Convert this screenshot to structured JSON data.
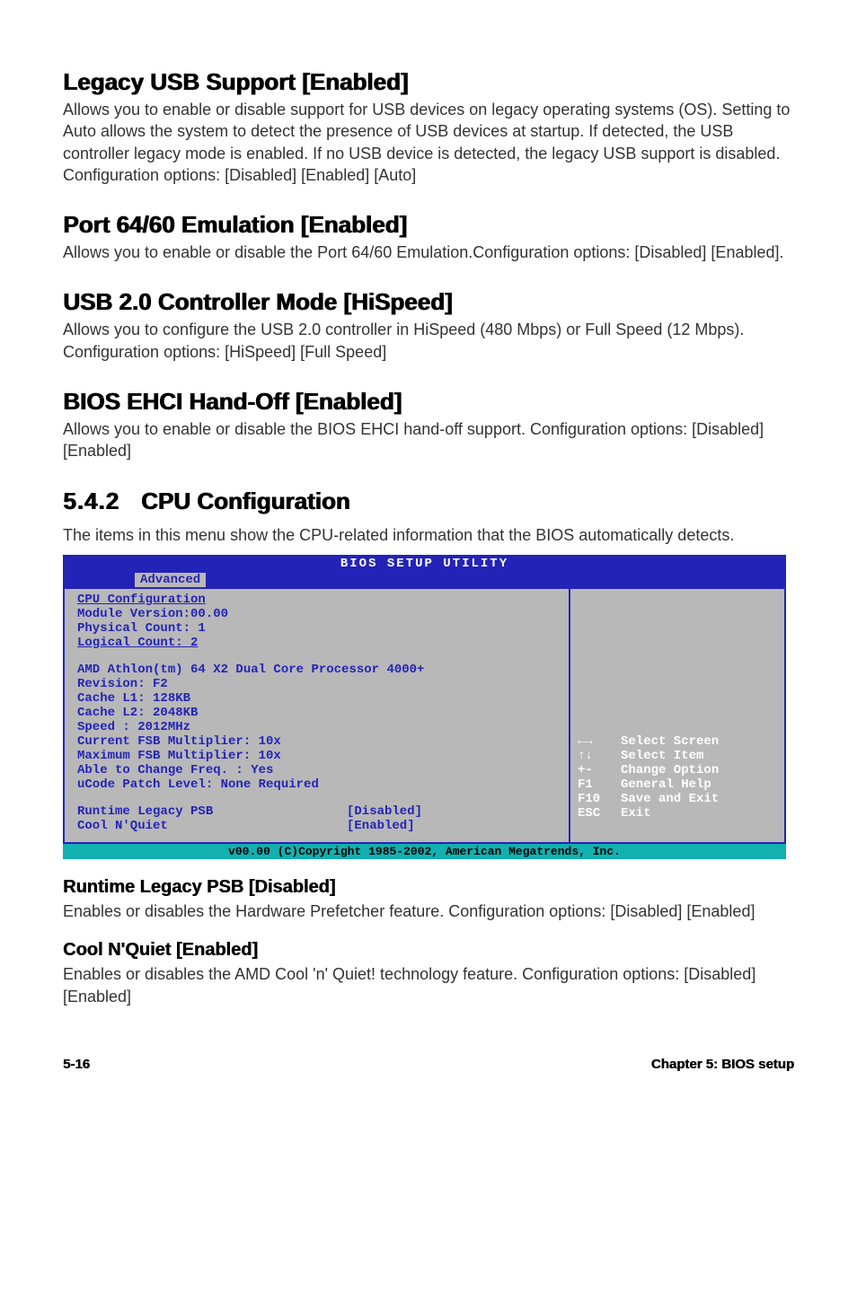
{
  "sections": {
    "legacy_usb": {
      "heading": "Legacy USB Support [Enabled]",
      "body": "Allows you to enable or disable support for USB devices on legacy operating systems (OS). Setting to Auto allows the system to detect the presence of USB devices at startup. If detected, the USB controller legacy mode is enabled. If no USB device is detected, the legacy USB support is disabled. Configuration options: [Disabled] [Enabled] [Auto]"
    },
    "port_6460": {
      "heading": "Port 64/60 Emulation [Enabled]",
      "body": "Allows you to enable or disable the Port 64/60 Emulation.Configuration options: [Disabled] [Enabled]."
    },
    "usb20_mode": {
      "heading": "USB 2.0 Controller Mode [HiSpeed]",
      "body": "Allows you to configure the USB 2.0 controller in HiSpeed (480 Mbps) or Full Speed (12 Mbps). Configuration options: [HiSpeed] [Full Speed]"
    },
    "bios_ehci": {
      "heading": "BIOS EHCI Hand-Off [Enabled]",
      "body": "Allows you to enable or disable the BIOS EHCI hand-off support. Configuration options: [Disabled] [Enabled]"
    },
    "cpu_config": {
      "heading_num": "5.4.2",
      "heading_title": "CPU Configuration",
      "body": "The items in this menu show the CPU-related information that the BIOS automatically detects."
    },
    "runtime_psb": {
      "heading": "Runtime Legacy PSB [Disabled]",
      "body": "Enables or disables the Hardware Prefetcher feature. Configuration options: [Disabled] [Enabled]"
    },
    "cool_n_quiet": {
      "heading": "Cool N'Quiet [Enabled]",
      "body": "Enables or disables the AMD Cool 'n' Quiet! technology feature. Configuration options: [Disabled] [Enabled]"
    }
  },
  "bios": {
    "title": "BIOS SETUP UTILITY",
    "tab": "Advanced",
    "left": {
      "header": "CPU Configuration",
      "module_version": "Module Version:00.00",
      "physical_count": "Physical Count: 1",
      "logical_count": "Logical Count: 2",
      "cpu_name": "AMD Athlon(tm) 64 X2 Dual Core Processor 4000+",
      "revision": "Revision: F2",
      "cache_l1": "Cache L1: 128KB",
      "cache_l2": "Cache L2: 2048KB",
      "speed": "Speed   : 2012MHz",
      "current_fsb": "Current FSB Multiplier: 10x",
      "max_fsb": "Maximum FSB Multiplier: 10x",
      "able_change": "Able to Change Freq. : Yes",
      "ucode": "uCode Patch Level: None Required",
      "setting1_label": "Runtime Legacy PSB",
      "setting1_value": "[Disabled]",
      "setting2_label": "Cool N'Quiet",
      "setting2_value": "[Enabled]"
    },
    "help": {
      "r1_key": "←→",
      "r1_label": "Select Screen",
      "r2_key": "↑↓",
      "r2_label": "Select Item",
      "r3_key": "+-",
      "r3_label": "Change Option",
      "r4_key": "F1",
      "r4_label": "General Help",
      "r5_key": "F10",
      "r5_label": "Save and Exit",
      "r6_key": "ESC",
      "r6_label": "Exit"
    },
    "copyright": "v00.00 (C)Copyright 1985-2002, American Megatrends, Inc."
  },
  "footer": {
    "left": "5-16",
    "right": "Chapter 5: BIOS setup"
  }
}
